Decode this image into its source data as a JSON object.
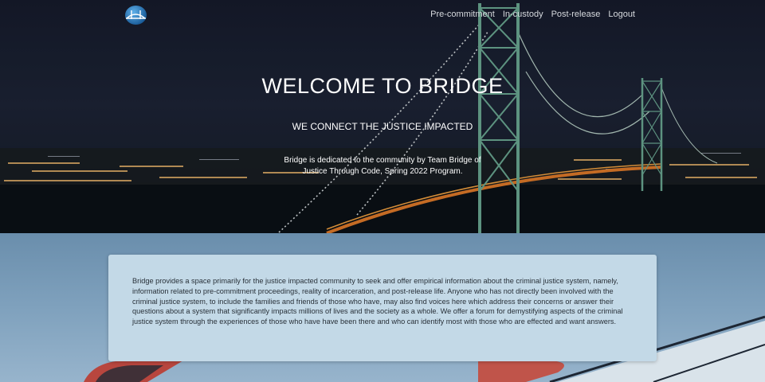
{
  "nav": {
    "logo_alt": "Bridge logo",
    "links": [
      {
        "label": "Pre-commitment"
      },
      {
        "label": "In-custody"
      },
      {
        "label": "Post-release"
      },
      {
        "label": "Logout"
      }
    ]
  },
  "hero": {
    "title": "WELCOME TO BRIDGE",
    "subtitle": "WE CONNECT THE JUSTICE IMPACTED",
    "description": "Bridge is dedicated to the community by Team Bridge of Justice Through Code, Spring 2022 Program."
  },
  "about": {
    "text": "Bridge provides a space primarily for the justice impacted community to seek and offer empirical information about the criminal justice system, namely, information related to pre-commitment proceedings, reality of incarceration, and post-release life. Anyone who has not directly been involved with the criminal justice system, to include the families and friends of those who have, may also find voices here which address their concerns or answer their questions about a system that significantly impacts millions of lives and the society as a whole. We offer a forum for demystifying aspects of the criminal justice system through the experiences of those who have have been there and who can identify most with those who are effected and want answers."
  },
  "colors": {
    "hero_dark": "#161b2c",
    "tower_green": "#5f9b86",
    "card_bg": "#c3d9e7",
    "lower_bg": "#7a9cb8"
  }
}
